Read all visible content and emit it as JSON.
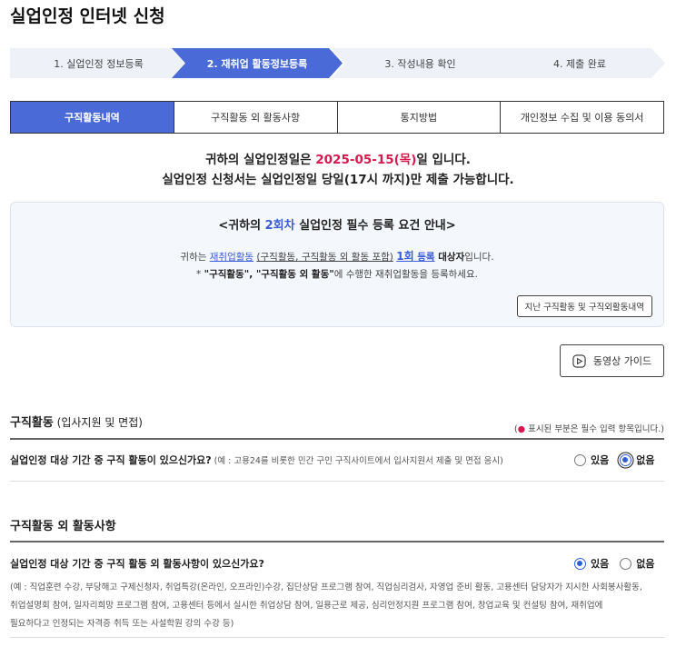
{
  "page": {
    "title": "실업인정 인터넷 신청"
  },
  "steps": [
    {
      "label": "1. 실업인정 정보등록",
      "active": false
    },
    {
      "label": "2. 재취업 활동정보등록",
      "active": true
    },
    {
      "label": "3. 작성내용 확인",
      "active": false
    },
    {
      "label": "4. 제출 완료",
      "active": false
    }
  ],
  "tabs": [
    {
      "label": "구직활동내역",
      "active": true
    },
    {
      "label": "구직활동 외 활동사항",
      "active": false
    },
    {
      "label": "통지방법",
      "active": false
    },
    {
      "label": "개인정보 수집 및 이용 동의서",
      "active": false
    }
  ],
  "notice": {
    "line1_prefix": "귀하의 실업인정일은 ",
    "date": "2025-05-15(목)",
    "line1_suffix": "일 입니다.",
    "line2": "실업인정 신청서는 실업인정일 당일(17시 까지)만 제출 가능합니다."
  },
  "guide": {
    "title_prefix": "<귀하의 ",
    "round": "2회차",
    "title_suffix": " 실업인정 필수 등록 요건 안내>",
    "line1_prefix": "귀하는 ",
    "link1": "재취업활동",
    "paren": "(구직활동, 구직활동 외 활동 포함)",
    "count_num": "1회",
    "count_word": " 등록",
    "line1_suffix_bold": " 대상자",
    "line1_suffix": "입니다.",
    "line2_star": "* ",
    "line2_bold": "\"구직활동\", \"구직활동 외 활동\"",
    "line2_rest": "에 수행한 재취업활동을 등록하세요.",
    "history_button": "지난 구직활동 및 구직외활동내역"
  },
  "video_button": {
    "label": "동영상 가이드",
    "icon": "play-icon"
  },
  "section1": {
    "title": "구직활동",
    "title_sub": " (입사지원 및 면접)",
    "required_note_open": "(",
    "required_note_dot": "●",
    "required_note_text": " 표시된 부분은 필수 입력 항목입니다.)",
    "question": "실업인정 대상 기간 중 구직 활동이 있으신가요?",
    "example": " (예 : 고용24를 비롯한 민간 구인 구직사이트에서 입사지원서 제출 및 면접 응시)",
    "yes": "있음",
    "no": "없음",
    "selected": "no"
  },
  "section2": {
    "title": "구직활동 외 활동사항",
    "question": "실업인정 대상 기간 중 구직 활동 외 활동사항이 있으신가요?",
    "yes": "있음",
    "no": "없음",
    "selected": "yes",
    "example_line1": "(예 : 직업훈련 수강, 부당해고 구제신청자, 취업특강(온라인, 오프라인)수강, 집단상담 프로그램 참여, 직업심리검사, 자영업 준비 활동, 고용센터 담당자가 지시한 사회봉사활동,",
    "example_line2": "취업설명회 참여, 일자리희망 프로그램 참여, 고용센터 등에서 실시한 취업상담 참여, 일용근로 제공, 심리안정지원 프로그램 참여, 창업교육 및 컨설팅 참여, 재취업에",
    "example_line3": "필요하다고 인정되는 자격증 취득 또는 사설학원 강의 수강 등)"
  }
}
